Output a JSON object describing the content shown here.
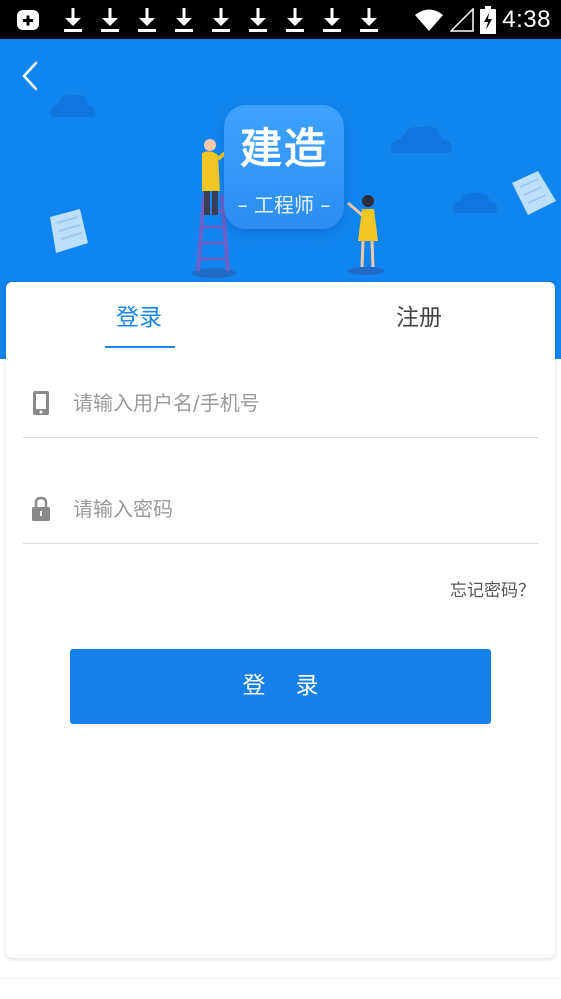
{
  "status_bar": {
    "time": "4:38",
    "icons": [
      "notification-add-icon",
      "download-icon",
      "download-icon",
      "download-icon",
      "download-icon",
      "download-icon",
      "download-icon",
      "download-icon",
      "download-icon",
      "download-icon",
      "wifi-icon",
      "signal-icon",
      "battery-charging-icon"
    ]
  },
  "header": {
    "back_icon": "chevron-left-icon",
    "badge_title": "建造",
    "badge_subtitle": "– 工程师 –"
  },
  "tabs": {
    "login_label": "登录",
    "register_label": "注册",
    "active": "login"
  },
  "form": {
    "username_placeholder": "请输入用户名/手机号",
    "username_value": "",
    "username_icon": "phone-icon",
    "password_placeholder": "请输入密码",
    "password_value": "",
    "password_icon": "lock-icon",
    "forgot_label": "忘记密码？",
    "submit_label": "登录"
  },
  "colors": {
    "primary": "#1185ef",
    "button": "#1580ea",
    "status_bar": "#000000"
  }
}
